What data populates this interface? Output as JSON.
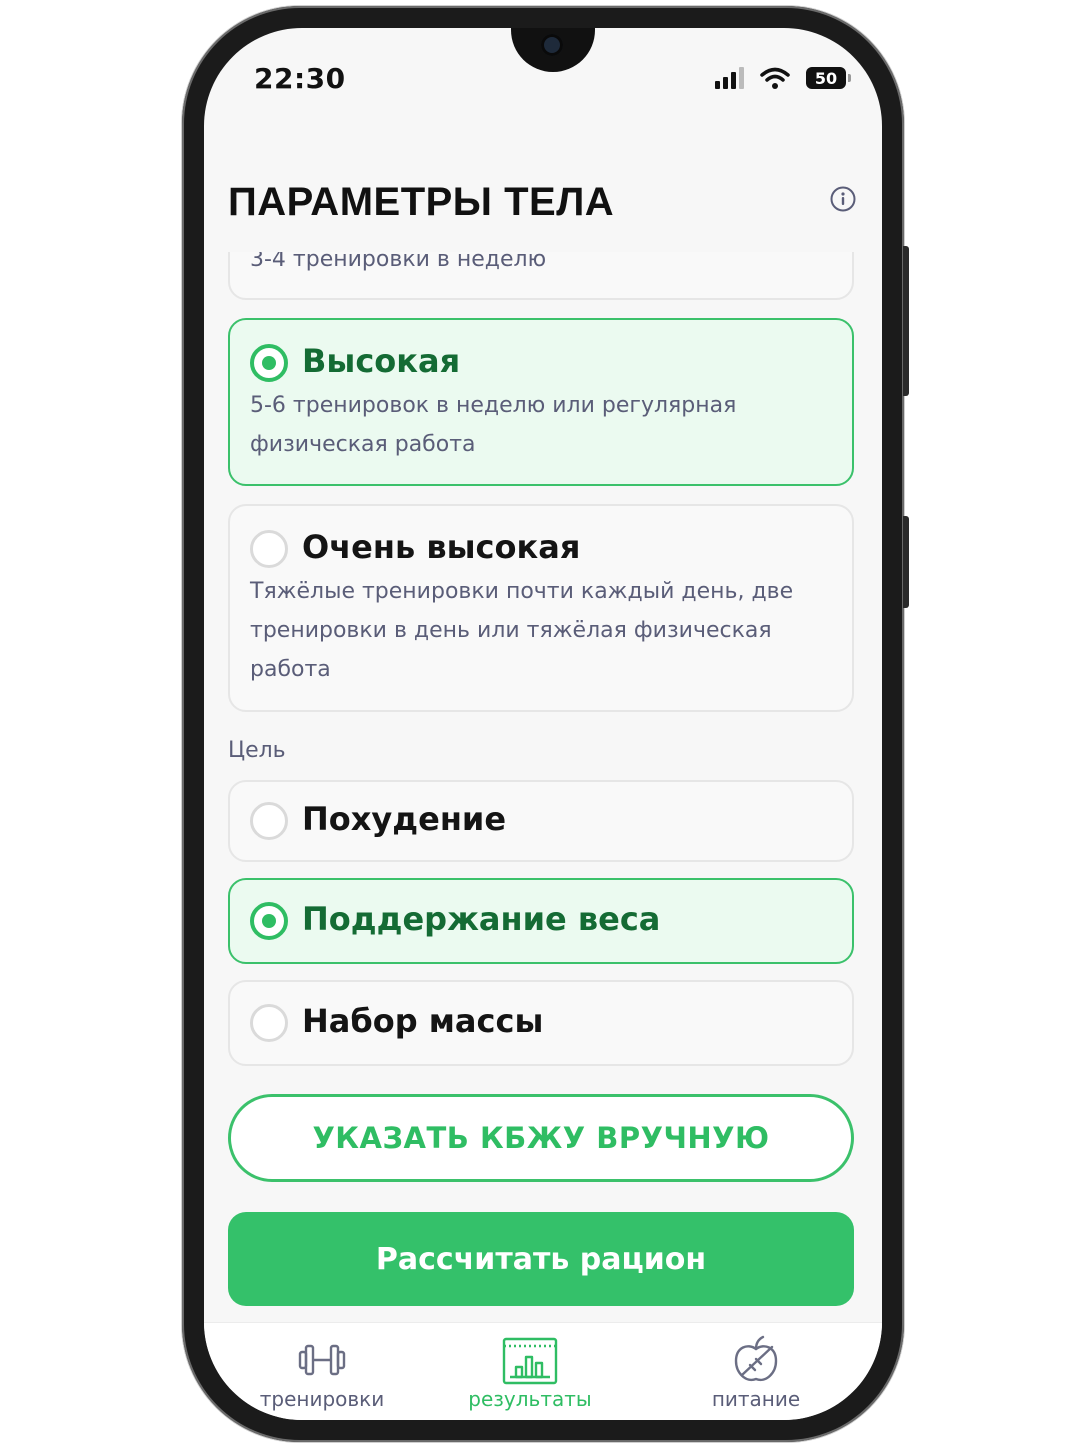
{
  "status_bar": {
    "time": "22:30",
    "battery": "50"
  },
  "header": {
    "title": "ПАРАМЕТРЫ ТЕЛА"
  },
  "activity": {
    "partial_desc": "3-4 тренировки в неделю",
    "options": [
      {
        "title": "Высокая",
        "desc": "5-6 тренировок в неделю или регулярная физическая работа",
        "selected": true
      },
      {
        "title": "Очень высокая",
        "desc": "Тяжёлые тренировки почти каждый день, две тренировки в день или тяжёлая физическая работа",
        "selected": false
      }
    ]
  },
  "goal": {
    "label": "Цель",
    "options": [
      {
        "title": "Похудение",
        "selected": false
      },
      {
        "title": "Поддержание веса",
        "selected": true
      },
      {
        "title": "Набор массы",
        "selected": false
      }
    ]
  },
  "buttons": {
    "manual": "УКАЗАТЬ КБЖУ ВРУЧНУЮ",
    "calculate": "Рассчитать рацион"
  },
  "tabs": [
    {
      "label": "тренировки",
      "icon": "dumbbell-icon",
      "active": false
    },
    {
      "label": "результаты",
      "icon": "chart-icon",
      "active": true
    },
    {
      "label": "питание",
      "icon": "apple-icon",
      "active": false
    }
  ],
  "colors": {
    "accent": "#34c16a",
    "accent_dark": "#146b34",
    "selected_bg": "#ebfaf0",
    "muted_text": "#5a5d78"
  }
}
